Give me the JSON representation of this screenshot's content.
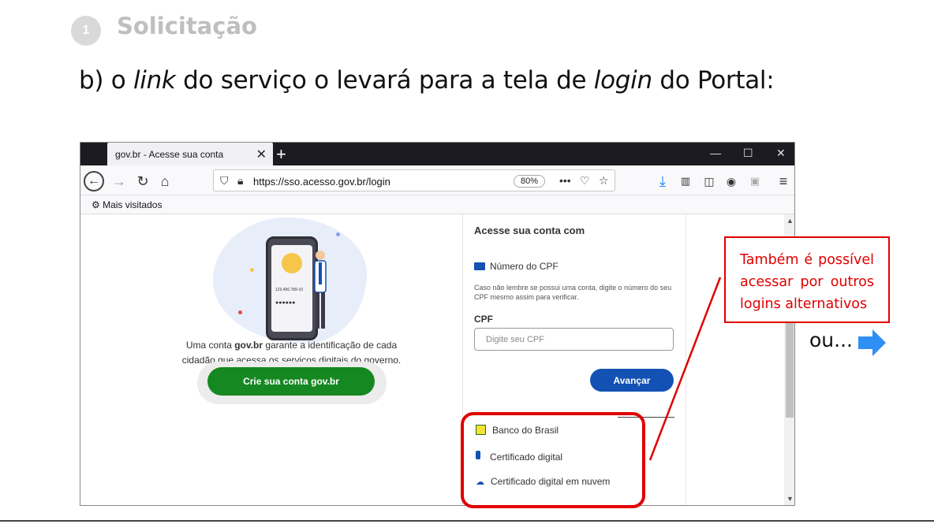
{
  "slide": {
    "step_number": "1",
    "step_title": "Solicitação",
    "subtitle_pre": "b) o ",
    "subtitle_link": "link",
    "subtitle_mid": " do serviço o levará para a tela de ",
    "subtitle_login": "login",
    "subtitle_post": " do Portal:"
  },
  "browser": {
    "tab_title": "gov.br - Acesse sua conta",
    "tab_close": "✕",
    "new_tab": "+",
    "window_controls": [
      "—",
      "☐",
      "✕"
    ],
    "url": "https://sso.acesso.gov.br/login",
    "zoom": "80%",
    "bookmark": "Mais visitados",
    "icons": [
      "back-icon",
      "forward-icon",
      "reload-icon",
      "home-icon",
      "shield-icon",
      "lock-icon",
      "more-icon",
      "pocket-icon",
      "star-icon",
      "download-icon",
      "library-icon",
      "sidebar-icon",
      "account-icon",
      "extension-icon",
      "menu-icon"
    ]
  },
  "page": {
    "illustration": {
      "cpf_sample": "123.456.789-10",
      "password_sample": "●●●●●●"
    },
    "left_text_1": "Uma conta ",
    "left_text_bold": "gov.br",
    "left_text_2": " garante a identificação de cada cidadão que acessa os serviços digitais do governo.",
    "create_button": "Crie sua conta gov.br",
    "panel_title": "Acesse sua conta com",
    "cpf_option": "Número do CPF",
    "hint": "Caso não lembre se possui uma conta, digite o número do seu CPF mesmo assim para verificar.",
    "cpf_label": "CPF",
    "cpf_placeholder": "Digite seu CPF",
    "advance_button": "Avançar",
    "alternatives": [
      {
        "label": "Banco do Brasil",
        "icon": "bank-icon"
      },
      {
        "label": "Certificado digital",
        "icon": "usb-token-icon"
      },
      {
        "label": "Certificado digital em nuvem",
        "icon": "cloud-icon"
      }
    ]
  },
  "annotation": {
    "callout": "Também é possível acessar por outros logins alternativos",
    "ou": "ou...",
    "colors": {
      "red": "#e00000",
      "arrow": "#2f8ff5",
      "gov_green": "#168821",
      "gov_blue": "#1351b4"
    }
  }
}
